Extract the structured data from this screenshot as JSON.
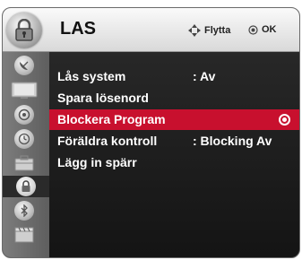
{
  "menu": {
    "title": "LAS",
    "header_icon": "lock-icon"
  },
  "hints": {
    "move": {
      "icon": "directional-pad-icon",
      "label": "Flytta"
    },
    "ok": {
      "icon": "ok-button-icon",
      "label": "OK"
    }
  },
  "sidebar": {
    "items": [
      {
        "icon": "satellite-dish-icon",
        "active": false
      },
      {
        "icon": "tv-screen-icon",
        "active": false
      },
      {
        "icon": "speaker-icon",
        "active": false
      },
      {
        "icon": "clock-icon",
        "active": false
      },
      {
        "icon": "option-icon",
        "active": false
      },
      {
        "icon": "lock-icon",
        "active": true
      },
      {
        "icon": "usb-icon",
        "active": false
      },
      {
        "icon": "film-icon",
        "active": false
      }
    ]
  },
  "items": [
    {
      "label": "Lås system",
      "value": ": Av",
      "selected": false
    },
    {
      "label": "Spara lösenord",
      "value": "",
      "selected": false
    },
    {
      "label": "Blockera Program",
      "value": "",
      "selected": true,
      "indicator": "radio-selected-icon"
    },
    {
      "label": "Föräldra kontroll",
      "value": ": Blocking Av",
      "selected": false
    },
    {
      "label": "Lägg in spärr",
      "value": "",
      "selected": false
    }
  ],
  "colors": {
    "highlight": "#c8102e",
    "background": "#1e1e1e",
    "header": "#e6e6e6",
    "text": "#ffffff"
  }
}
